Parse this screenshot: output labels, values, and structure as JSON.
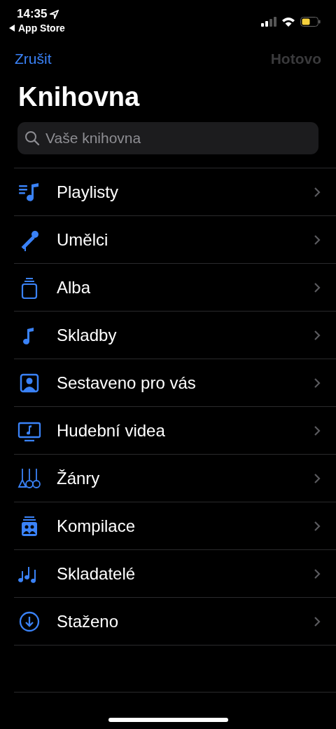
{
  "status_bar": {
    "time": "14:35",
    "back_app": "App Store"
  },
  "nav": {
    "cancel": "Zrušit",
    "done": {
      "label": "Hotovo",
      "disabled": true
    }
  },
  "title": "Knihovna",
  "search": {
    "placeholder": "Vaše knihovna"
  },
  "items": [
    {
      "kind": "playlists",
      "label": "Playlisty"
    },
    {
      "kind": "artists",
      "label": "Umělci"
    },
    {
      "kind": "albums",
      "label": "Alba"
    },
    {
      "kind": "songs",
      "label": "Skladby"
    },
    {
      "kind": "foryou",
      "label": "Sestaveno pro vás"
    },
    {
      "kind": "videos",
      "label": "Hudební videa"
    },
    {
      "kind": "genres",
      "label": "Žánry"
    },
    {
      "kind": "compilations",
      "label": "Kompilace"
    },
    {
      "kind": "composers",
      "label": "Skladatelé"
    },
    {
      "kind": "downloaded",
      "label": "Staženo"
    }
  ]
}
